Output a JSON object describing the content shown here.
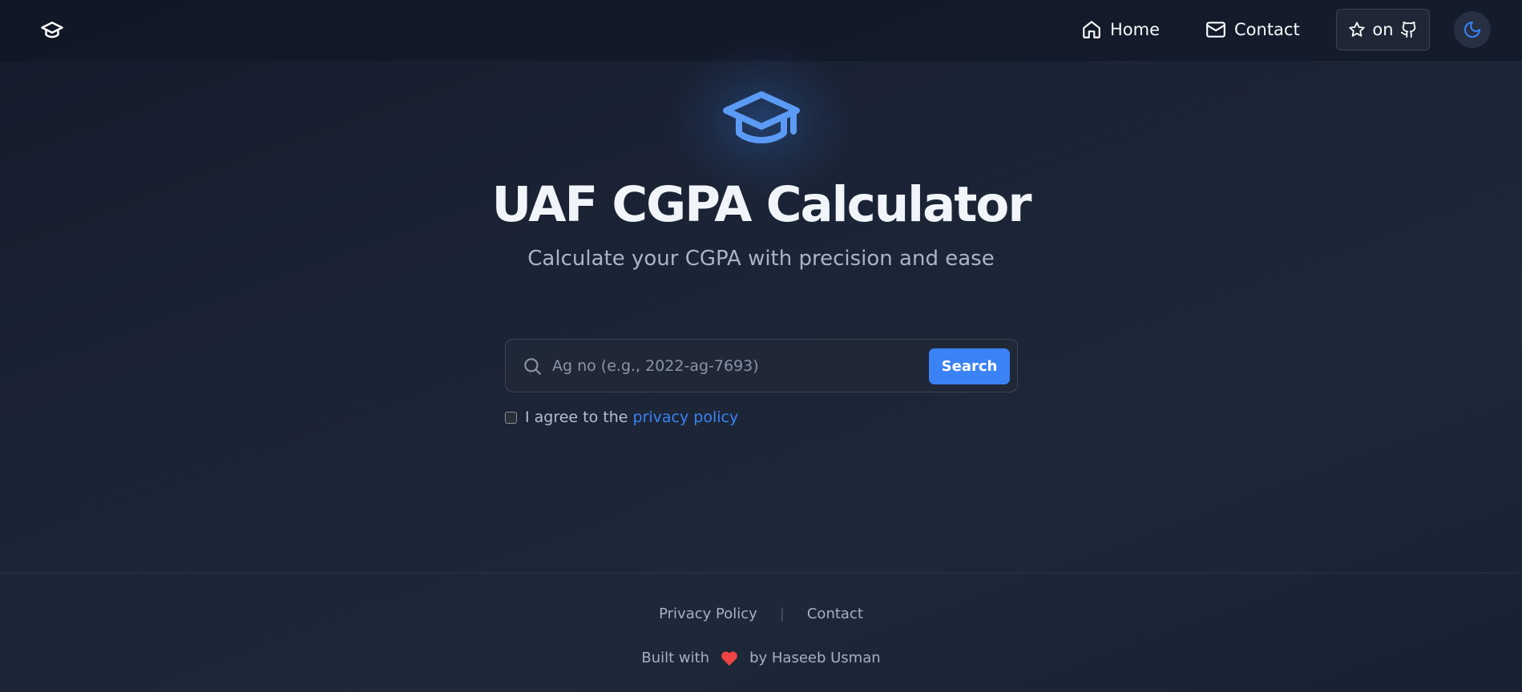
{
  "nav": {
    "home_label": "Home",
    "contact_label": "Contact",
    "star_label": "on"
  },
  "hero": {
    "title": "UAF CGPA Calculator",
    "subtitle": "Calculate your CGPA with precision and ease"
  },
  "search": {
    "placeholder": "Ag no (e.g., 2022-ag-7693)",
    "button_label": "Search"
  },
  "agreement": {
    "prefix": "I agree to the",
    "link_label": "privacy policy"
  },
  "footer": {
    "privacy_label": "Privacy Policy",
    "separator": "|",
    "contact_label": "Contact",
    "credit_prefix": "Built with",
    "credit_suffix": "by Haseeb Usman"
  },
  "colors": {
    "accent": "#3b82f6",
    "heart": "#ef4444",
    "background": "#1b2436"
  },
  "icons": {
    "logo": "graduation-cap-icon",
    "home": "home-icon",
    "contact": "mail-icon",
    "star": "star-icon",
    "github": "github-icon",
    "theme": "moon-icon",
    "search": "search-icon",
    "heart": "heart-icon"
  }
}
